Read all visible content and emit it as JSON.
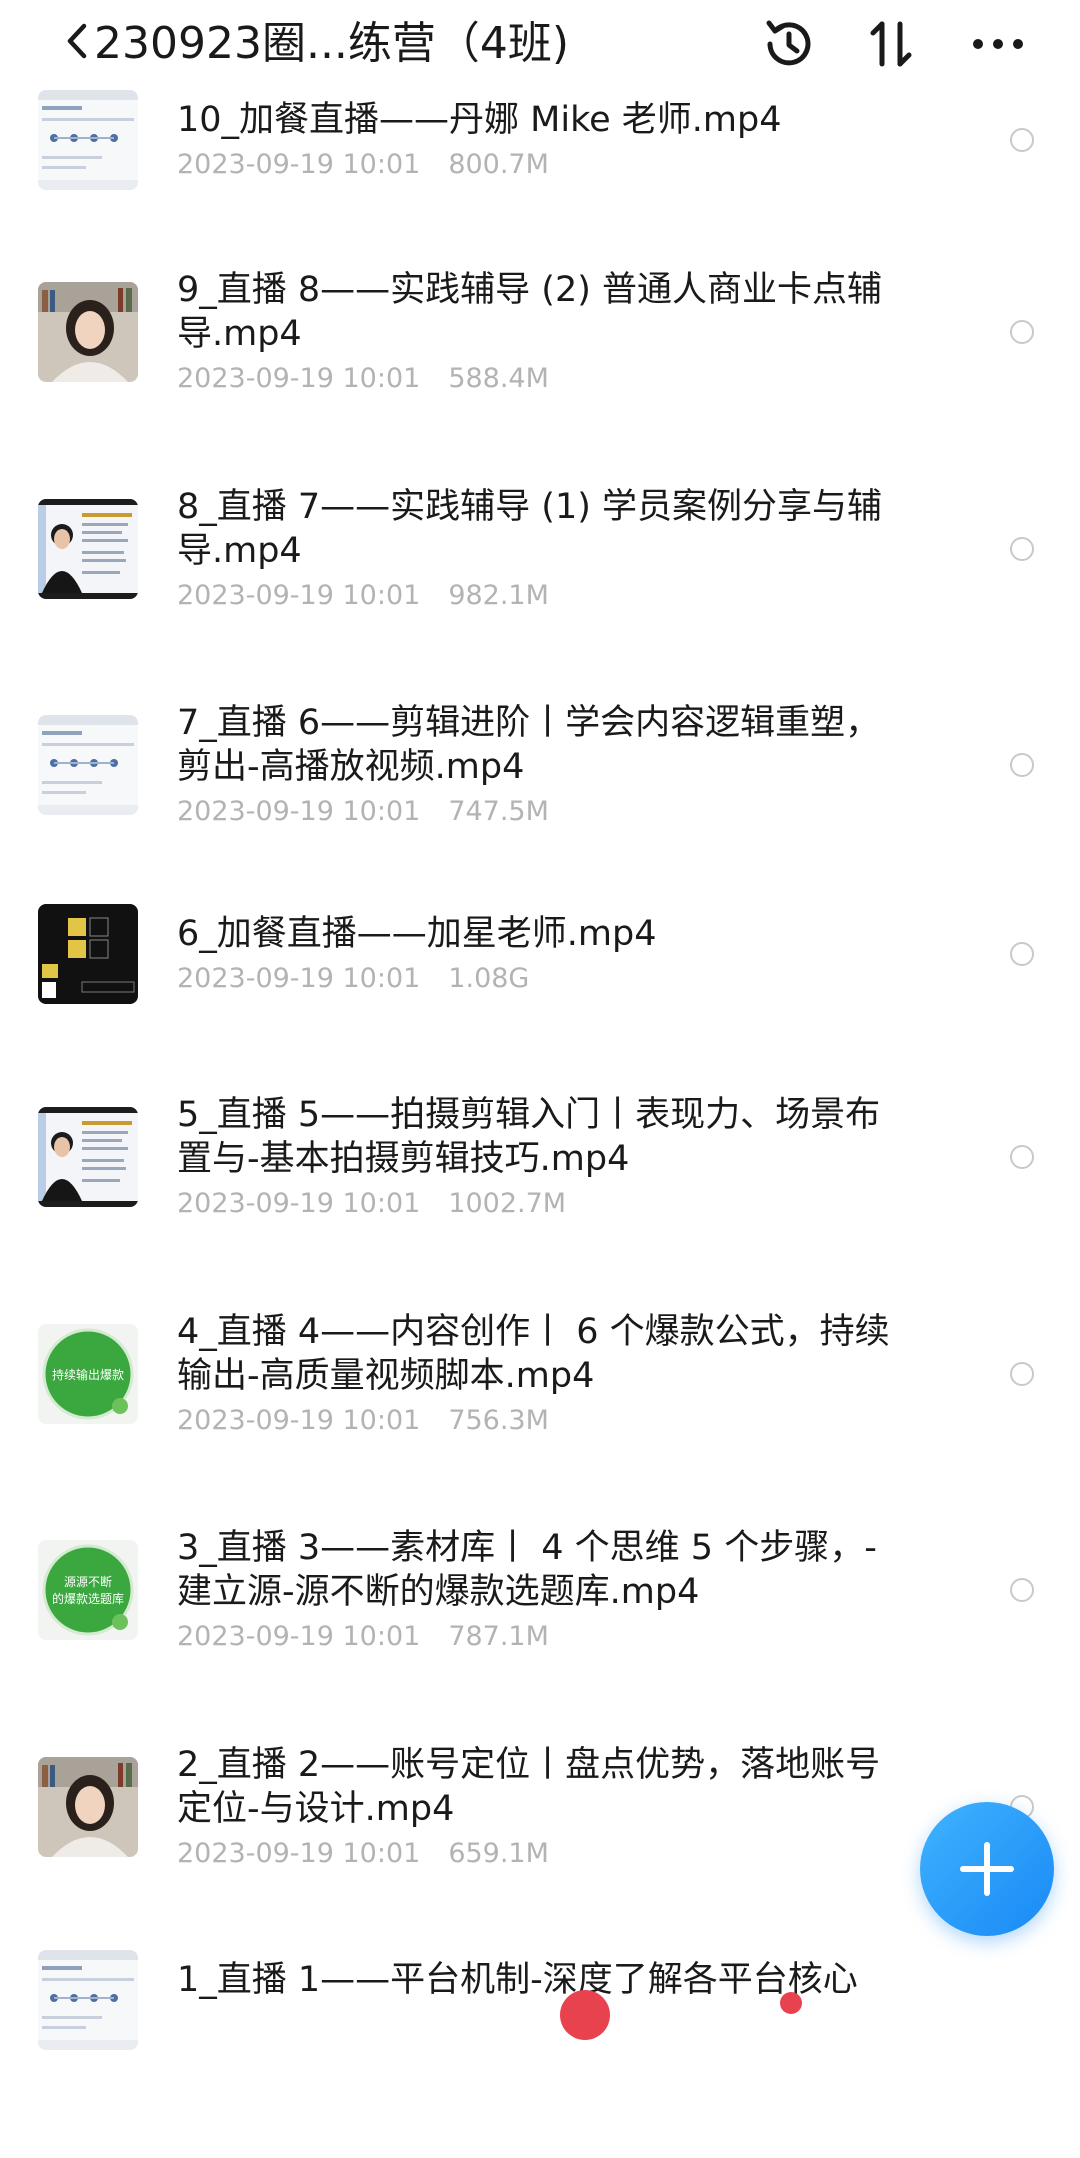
{
  "header": {
    "title": "230923圈...练营（4班)",
    "icons": [
      "back-icon",
      "history-icon",
      "sort-icon",
      "more-icon"
    ]
  },
  "files": [
    {
      "name": "10_加餐直播——丹娜 Mike 老师.mp4",
      "date": "2023-09-19 10:01",
      "size": "800.7M",
      "thumb": "screen"
    },
    {
      "name": "9_直播 8——实践辅导 (2) 普通人商业卡点辅导.mp4",
      "date": "2023-09-19 10:01",
      "size": "588.4M",
      "thumb": "woman"
    },
    {
      "name": "8_直播 7——实践辅导 (1) 学员案例分享与辅导.mp4",
      "date": "2023-09-19 10:01",
      "size": "982.1M",
      "thumb": "man-slide"
    },
    {
      "name": "7_直播 6——剪辑进阶丨学会内容逻辑重塑，剪出-高播放视频.mp4",
      "date": "2023-09-19 10:01",
      "size": "747.5M",
      "thumb": "screen"
    },
    {
      "name": "6_加餐直播——加星老师.mp4",
      "date": "2023-09-19 10:01",
      "size": "1.08G",
      "thumb": "dark-slide"
    },
    {
      "name": "5_直播 5——拍摄剪辑入门丨表现力、场景布置与-基本拍摄剪辑技巧.mp4",
      "date": "2023-09-19 10:01",
      "size": "1002.7M",
      "thumb": "man-slide"
    },
    {
      "name": "4_直播 4——内容创作丨 6 个爆款公式，持续输出-高质量视频脚本.mp4",
      "date": "2023-09-19 10:01",
      "size": "756.3M",
      "thumb": "green-circle",
      "thumb_text": "持续输出爆款"
    },
    {
      "name": "3_直播 3——素材库丨 4 个思维 5 个步骤，-建立源-源不断的爆款选题库.mp4",
      "date": "2023-09-19 10:01",
      "size": "787.1M",
      "thumb": "green-circle",
      "thumb_text": "源源不断的爆款选题库"
    },
    {
      "name": "2_直播 2——账号定位丨盘点优势，落地账号定位-与设计.mp4",
      "date": "2023-09-19 10:01",
      "size": "659.1M",
      "thumb": "woman"
    },
    {
      "name": "1_直播 1——平台机制-深度了解各平台核心",
      "date": "",
      "size": "",
      "thumb": "screen"
    }
  ],
  "fab": {
    "icon": "plus-icon"
  },
  "colors": {
    "accent": "#1989f5",
    "meta": "#b3b3b3",
    "green": "#2fb24a"
  }
}
